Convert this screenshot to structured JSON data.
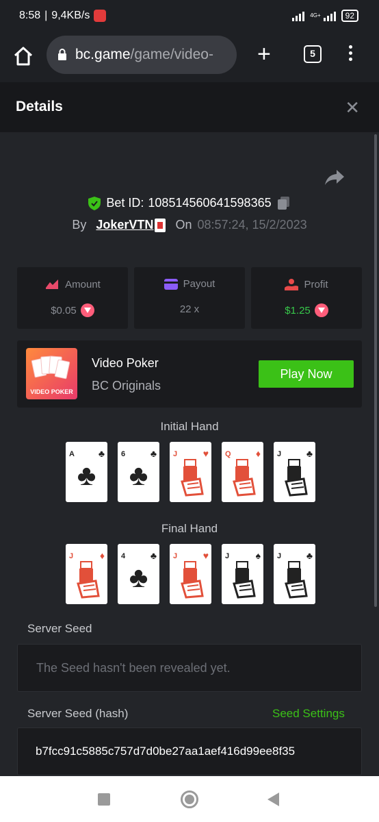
{
  "status_bar": {
    "time": "8:58",
    "speed": "9,4KB/s",
    "network": "4G+",
    "battery": "92"
  },
  "browser": {
    "url_host": "bc.game",
    "url_path": "/game/video-",
    "tab_count": "5"
  },
  "header": {
    "title": "Details"
  },
  "bet": {
    "id_label": "Bet ID:",
    "id": "108514560641598365",
    "by_label": "By",
    "user": "JokerVTN",
    "on_label": "On",
    "time": "08:57:24, 15/2/2023"
  },
  "stats": {
    "amount": {
      "label": "Amount",
      "value": "$0.05"
    },
    "payout": {
      "label": "Payout",
      "value": "22 x"
    },
    "profit": {
      "label": "Profit",
      "value": "$1.25"
    }
  },
  "game": {
    "thumb_label": "VIDEO POKER",
    "title": "Video Poker",
    "subtitle": "BC Originals",
    "play_label": "Play Now"
  },
  "initial_hand": {
    "label": "Initial Hand",
    "cards": [
      {
        "rank": "A",
        "suit": "♣",
        "color": "black"
      },
      {
        "rank": "6",
        "suit": "♣",
        "color": "black"
      },
      {
        "rank": "J",
        "suit": "♥",
        "color": "red"
      },
      {
        "rank": "Q",
        "suit": "♦",
        "color": "red"
      },
      {
        "rank": "J",
        "suit": "♣",
        "color": "black"
      }
    ]
  },
  "final_hand": {
    "label": "Final Hand",
    "cards": [
      {
        "rank": "J",
        "suit": "♦",
        "color": "red"
      },
      {
        "rank": "4",
        "suit": "♣",
        "color": "black"
      },
      {
        "rank": "J",
        "suit": "♥",
        "color": "red"
      },
      {
        "rank": "J",
        "suit": "♠",
        "color": "black"
      },
      {
        "rank": "J",
        "suit": "♣",
        "color": "black"
      }
    ]
  },
  "server_seed": {
    "label": "Server Seed",
    "message": "The Seed hasn't been revealed yet."
  },
  "server_seed_hash": {
    "label": "Server Seed (hash)",
    "settings_label": "Seed Settings",
    "value": "b7fcc91c5885c757d7d0be27aa1aef416d99ee8f35"
  },
  "colors": {
    "accent_green": "#3bc117",
    "profit_green": "#37c84a",
    "coin_pink": "#ff5d7a"
  }
}
